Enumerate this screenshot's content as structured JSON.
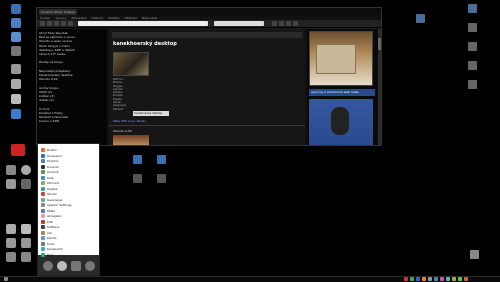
{
  "browser": {
    "tab_title": "Kaushal Ghaar bloguje",
    "menu": [
      "Soubor",
      "Úpravy",
      "Zobrazení",
      "Historie",
      "Záložky",
      "Nástroje",
      "Nápověda"
    ]
  },
  "page": {
    "post_title": "kanekhoerský desktop",
    "tooltip": "kanekhoerský desktop",
    "footer": "Štítky: KDE, Linux, Ubuntu",
    "section_title": "Ubuntu 9.04",
    "right_banner": "Aquí my z Aluminium web news",
    "left_paragraphs": [
      "Ahoj! Tady Kaushal.",
      "Rád se zajímám o Linux,",
      "Ubuntu a open source.",
      "Tento blog je o mém",
      "desktopu, KDE a dalších",
      "věcech z IT světa.",
      "",
      "Hledej na blogu:",
      "",
      "Nejnovější příspěvky:",
      "kanekhoerský desktop",
      "Ubuntu 9.04",
      "",
      "Archiv blogu:",
      "2009 (4)",
      "květen (2)",
      "duben (2)",
      "",
      "O mně:",
      "Kaushal z Prahy",
      "Student a fanoušek",
      "Linuxu a KDE."
    ],
    "table_rows": [
      "KDE 4.2",
      "Plasma",
      "Oxygen",
      "Amarok",
      "Dolphin",
      "Konsole",
      "Kopete",
      "Okular",
      "Gwenview",
      "KTorrent"
    ]
  },
  "start_menu": {
    "items": [
      "Firefox",
      "Konqueror",
      "Dolphin",
      "Konsole",
      "Amarok",
      "Kate",
      "KTorrent",
      "Kopete",
      "Okular",
      "Gwenview",
      "System Settings",
      "KMail",
      "Akregator",
      "K3b",
      "Kaffeine",
      "Ark",
      "Kwrite",
      "Kcalc",
      "Ksnapshot",
      "Help"
    ]
  },
  "colors": {
    "accent": "#274a8c",
    "link": "#88aaff"
  }
}
